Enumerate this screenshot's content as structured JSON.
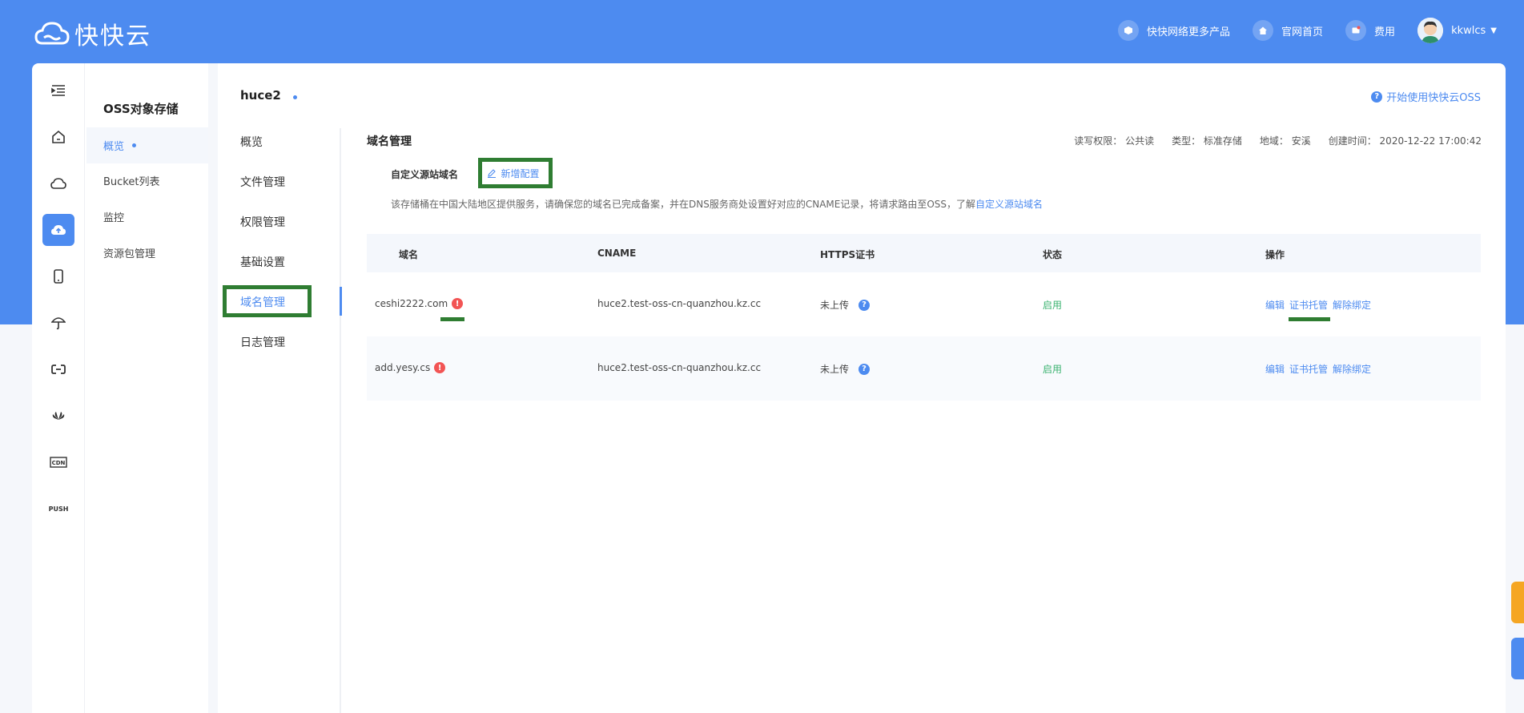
{
  "brand": {
    "name": "快快云"
  },
  "topnav": {
    "items": [
      {
        "label": "快快网络更多产品"
      },
      {
        "label": "官网首页"
      },
      {
        "label": "费用"
      }
    ],
    "user": "kkwlcs"
  },
  "sidebar": {
    "title": "OSS对象存储",
    "items": [
      {
        "label": "概览"
      },
      {
        "label": "Bucket列表"
      },
      {
        "label": "监控"
      },
      {
        "label": "资源包管理"
      }
    ]
  },
  "bucket": {
    "name": "huce2",
    "start_link": "开始使用快快云OSS",
    "menu": [
      {
        "label": "概览"
      },
      {
        "label": "文件管理"
      },
      {
        "label": "权限管理"
      },
      {
        "label": "基础设置"
      },
      {
        "label": "域名管理"
      },
      {
        "label": "日志管理"
      }
    ]
  },
  "domain": {
    "title": "域名管理",
    "meta": {
      "acl": "读写权限： 公共读",
      "type": "类型： 标准存储",
      "region": "地域： 安溪",
      "created": "创建时间： 2020-12-22 17:00:42"
    },
    "custom_label": "自定义源站域名",
    "add_label": "新增配置",
    "desc": "该存储桶在中国大陆地区提供服务，请确保您的域名已完成备案，并在DNS服务商处设置好对应的CNAME记录，将请求路由至OSS，了解",
    "desc_link": "自定义源站域名",
    "table": {
      "headers": [
        "域名",
        "CNAME",
        "HTTPS证书",
        "状态",
        "操作"
      ],
      "rows": [
        {
          "domain": "ceshi2222.com",
          "cname": "huce2.test-oss-cn-quanzhou.kz.cc",
          "https": "未上传",
          "status": "启用",
          "ops": [
            "编辑",
            "证书托管",
            "解除绑定"
          ]
        },
        {
          "domain": "add.yesy.cs",
          "cname": "huce2.test-oss-cn-quanzhou.kz.cc",
          "https": "未上传",
          "status": "启用",
          "ops": [
            "编辑",
            "证书托管",
            "解除绑定"
          ]
        }
      ]
    }
  },
  "colors": {
    "primary": "#4d8bf0",
    "highlight": "#2f7d32",
    "danger": "#f25454",
    "success": "#3cb371"
  }
}
